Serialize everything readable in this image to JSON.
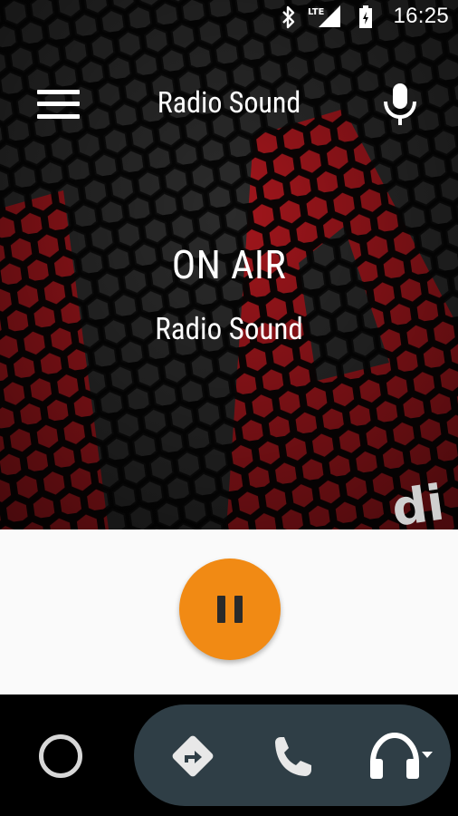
{
  "status_bar": {
    "time": "16:25",
    "network": "LTE",
    "icons": [
      "bluetooth-icon",
      "lte-signal-icon",
      "battery-icon"
    ]
  },
  "toolbar": {
    "title": "Radio Sound",
    "menu_icon": "hamburger-menu-icon",
    "mic_icon": "microphone-icon"
  },
  "now_playing": {
    "status": "ON AIR",
    "station": "Radio Sound"
  },
  "player": {
    "play_state_icon": "pause-icon",
    "accent_color": "#f18a14"
  },
  "nav_bar": {
    "items": [
      "home-circle-icon",
      "navigation-icon",
      "phone-icon",
      "headphones-icon"
    ],
    "pill_color": "#2f3e46"
  },
  "artwork": {
    "text": "di"
  }
}
